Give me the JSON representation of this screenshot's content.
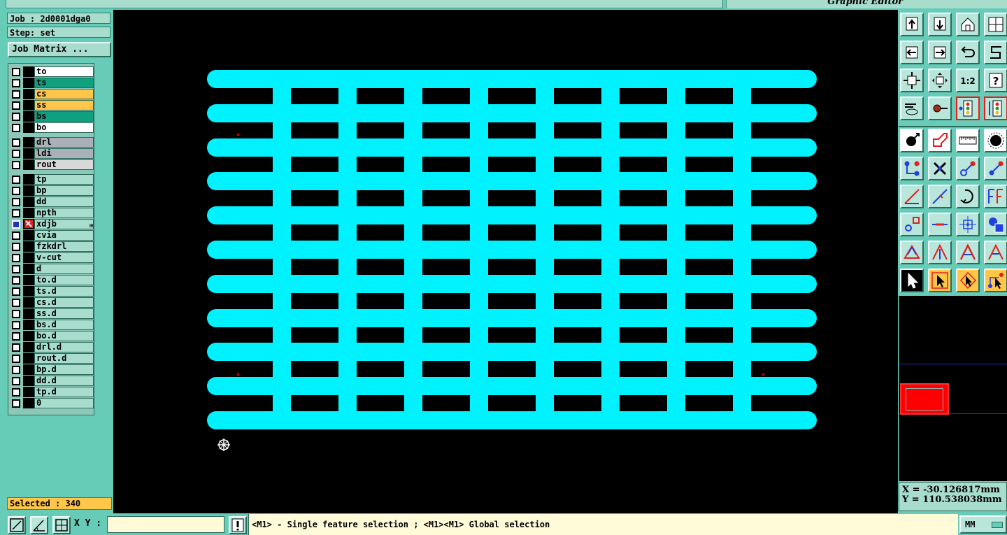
{
  "window": {
    "title": "Graphic Editor"
  },
  "left": {
    "job": "Job : 2d0001dga0",
    "step": "Step: set",
    "job_matrix_label": "Job Matrix ...",
    "selected": "Selected : 340"
  },
  "layers": {
    "board": [
      {
        "name": "to",
        "color": "#ffffff"
      },
      {
        "name": "ts",
        "color": "#10a080"
      },
      {
        "name": "cs",
        "color": "#ffc64a"
      },
      {
        "name": "ss",
        "color": "#ffc64a"
      },
      {
        "name": "bs",
        "color": "#10a080"
      },
      {
        "name": "bo",
        "color": "#ffffff"
      }
    ],
    "drill": [
      {
        "name": "drl",
        "color": "#aab0b8"
      },
      {
        "name": "ldi",
        "color": "#aab0b8"
      },
      {
        "name": "rout",
        "color": "#d8d8d8"
      }
    ],
    "misc": [
      {
        "name": "tp",
        "color": "#a8dccd"
      },
      {
        "name": "bp",
        "color": "#a8dccd"
      },
      {
        "name": "dd",
        "color": "#a8dccd"
      },
      {
        "name": "npth",
        "color": "#a8dccd"
      },
      {
        "name": "xdjb",
        "color": "#a8dccd",
        "active": true
      },
      {
        "name": "cvia",
        "color": "#a8dccd"
      },
      {
        "name": "fzkdrl",
        "color": "#a8dccd"
      },
      {
        "name": "v-cut",
        "color": "#a8dccd"
      },
      {
        "name": "d",
        "color": "#a8dccd"
      },
      {
        "name": "to.d",
        "color": "#a8dccd"
      },
      {
        "name": "ts.d",
        "color": "#a8dccd"
      },
      {
        "name": "cs.d",
        "color": "#a8dccd"
      },
      {
        "name": "ss.d",
        "color": "#a8dccd"
      },
      {
        "name": "bs.d",
        "color": "#a8dccd"
      },
      {
        "name": "bo.d",
        "color": "#a8dccd"
      },
      {
        "name": "drl.d",
        "color": "#a8dccd"
      },
      {
        "name": "rout.d",
        "color": "#a8dccd"
      },
      {
        "name": "bp.d",
        "color": "#a8dccd"
      },
      {
        "name": "dd.d",
        "color": "#a8dccd"
      },
      {
        "name": "tp.d",
        "color": "#a8dccd"
      },
      {
        "name": "0",
        "color": "#a8dccd"
      }
    ]
  },
  "coords": {
    "x": "X = -30.126817mm",
    "y": "Y = 110.538038mm"
  },
  "bottom": {
    "xy_label": "X Y :",
    "xy_value": "",
    "hint": "<M1> - Single feature selection ; <M1><M1> Global selection",
    "units": "MM"
  },
  "canvas": {
    "feature_color": "#00f2ff",
    "background": "#000000",
    "grid_rows": 11,
    "grid_inner_columns": 7
  },
  "toolbar_icons": [
    "layer-up-icon",
    "layer-down-icon",
    "home-icon",
    "window-icon",
    "pan-left-icon",
    "pan-right-icon",
    "rotate-icon",
    "step-icon",
    "zoom-fit-icon",
    "zoom-center-icon",
    "zoom-1-2-icon",
    "help-icon",
    "measure-tools-icon",
    "probe-icon",
    "net-select-icon",
    "net-compare-icon",
    "add-pad-icon",
    "draw-outline-icon",
    "ruler-icon",
    "filled-circle-icon",
    "connect-icon",
    "delete-feature-icon",
    "move-point-icon",
    "copy-point-icon",
    "draw-line-icon",
    "edit-line-icon",
    "arc-icon",
    "text-icon",
    "snap-icon",
    "minus-line-icon",
    "center-icon",
    "shapes-icon",
    "polygon-icon",
    "polygon-edit-icon",
    "polygon-fill-icon",
    "polygon-outline-icon",
    "select-arrow-icon",
    "select-box-icon",
    "select-poly-icon",
    "select-net-icon"
  ],
  "toolbar": {
    "zoom_label": "1:2"
  }
}
